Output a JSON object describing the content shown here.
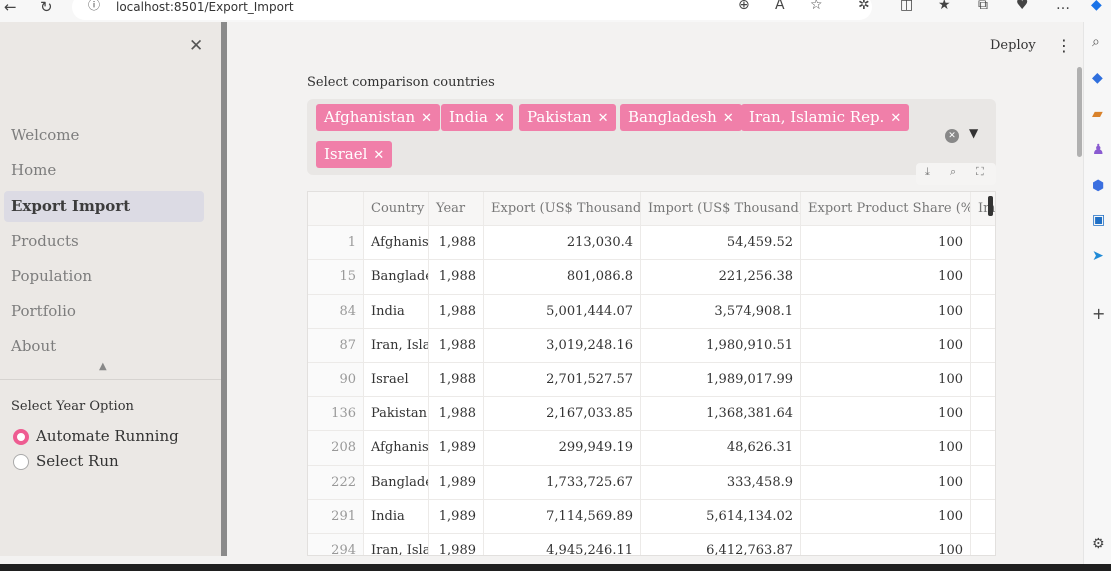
{
  "browser": {
    "url": "localhost:8501/Export_Import"
  },
  "sidebar": {
    "items": [
      {
        "label": "Welcome"
      },
      {
        "label": "Home"
      },
      {
        "label": "Export Import"
      },
      {
        "label": "Products"
      },
      {
        "label": "Population"
      },
      {
        "label": "Portfolio"
      },
      {
        "label": "About"
      }
    ],
    "year_option_label": "Select Year Option",
    "options": [
      {
        "label": "Automate Running",
        "selected": true
      },
      {
        "label": "Select Run",
        "selected": false
      }
    ]
  },
  "header": {
    "deploy_label": "Deploy"
  },
  "main": {
    "select_label": "Select comparison countries",
    "chips": [
      "Afghanistan",
      "India",
      "Pakistan",
      "Bangladesh",
      "Iran, Islamic Rep.",
      "Israel"
    ],
    "accent_color": "#f07fa9",
    "table": {
      "columns": [
        "Country",
        "Year",
        "Export (US$ Thousand)",
        "Import (US$ Thousand)",
        "Export Product Share (%)",
        "Im"
      ],
      "rows": [
        {
          "idx": "1",
          "country": "Afghanist",
          "year": "1,988",
          "export": "213,030.4",
          "import": "54,459.52",
          "share": "100"
        },
        {
          "idx": "15",
          "country": "Banglade",
          "year": "1,988",
          "export": "801,086.8",
          "import": "221,256.38",
          "share": "100"
        },
        {
          "idx": "84",
          "country": "India",
          "year": "1,988",
          "export": "5,001,444.07",
          "import": "3,574,908.1",
          "share": "100"
        },
        {
          "idx": "87",
          "country": "Iran, Islar",
          "year": "1,988",
          "export": "3,019,248.16",
          "import": "1,980,910.51",
          "share": "100"
        },
        {
          "idx": "90",
          "country": "Israel",
          "year": "1,988",
          "export": "2,701,527.57",
          "import": "1,989,017.99",
          "share": "100"
        },
        {
          "idx": "136",
          "country": "Pakistan",
          "year": "1,988",
          "export": "2,167,033.85",
          "import": "1,368,381.64",
          "share": "100"
        },
        {
          "idx": "208",
          "country": "Afghanist",
          "year": "1,989",
          "export": "299,949.19",
          "import": "48,626.31",
          "share": "100"
        },
        {
          "idx": "222",
          "country": "Banglade",
          "year": "1,989",
          "export": "1,733,725.67",
          "import": "333,458.9",
          "share": "100"
        },
        {
          "idx": "291",
          "country": "India",
          "year": "1,989",
          "export": "7,114,569.89",
          "import": "5,614,134.02",
          "share": "100"
        },
        {
          "idx": "294",
          "country": "Iran, Islar",
          "year": "1,989",
          "export": "4,945,246.11",
          "import": "6,412,763.87",
          "share": "100"
        }
      ]
    }
  }
}
